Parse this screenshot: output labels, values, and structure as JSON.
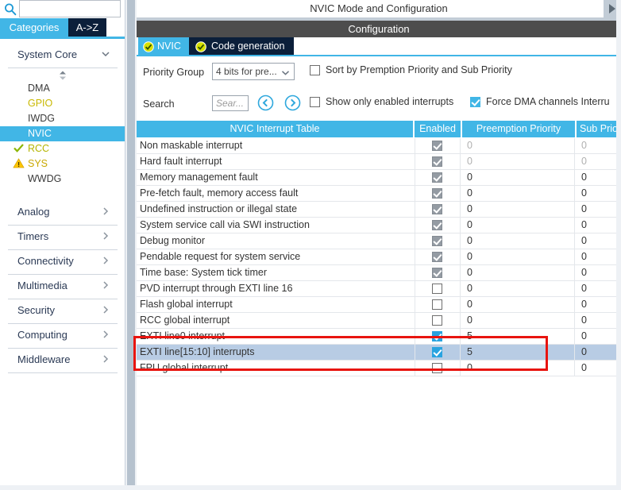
{
  "sidebar": {
    "search": {
      "placeholder": "",
      "value": "",
      "icon": "search-icon"
    },
    "tabs": [
      {
        "label": "Categories",
        "active": true
      },
      {
        "label": "A->Z",
        "active": false
      }
    ],
    "groups": [
      {
        "label": "System Core",
        "expanded": true,
        "items": [
          {
            "label": "DMA",
            "mark": "none",
            "selected": false
          },
          {
            "label": "GPIO",
            "mark": "none",
            "selected": false,
            "color": "#c9b800"
          },
          {
            "label": "IWDG",
            "mark": "none",
            "selected": false
          },
          {
            "label": "NVIC",
            "mark": "none",
            "selected": true
          },
          {
            "label": "RCC",
            "mark": "check",
            "selected": false,
            "color": "#b5b500"
          },
          {
            "label": "SYS",
            "mark": "warning",
            "selected": false,
            "color": "#c9a800"
          },
          {
            "label": "WWDG",
            "mark": "none",
            "selected": false
          }
        ]
      },
      {
        "label": "Analog",
        "expanded": false,
        "items": []
      },
      {
        "label": "Timers",
        "expanded": false,
        "items": []
      },
      {
        "label": "Connectivity",
        "expanded": false,
        "items": []
      },
      {
        "label": "Multimedia",
        "expanded": false,
        "items": []
      },
      {
        "label": "Security",
        "expanded": false,
        "items": []
      },
      {
        "label": "Computing",
        "expanded": false,
        "items": []
      },
      {
        "label": "Middleware",
        "expanded": false,
        "items": []
      }
    ]
  },
  "main": {
    "title": "NVIC Mode and Configuration",
    "configuration_bar": "Configuration",
    "tabs": [
      {
        "label": "NVIC",
        "active": true,
        "icon": "ok-check-icon"
      },
      {
        "label": "Code generation",
        "active": false,
        "icon": "ok-check-icon"
      }
    ],
    "controls": {
      "priority_group_label": "Priority Group",
      "priority_group_value": "4 bits for pre...",
      "search_label": "Search",
      "search_placeholder": "Sear...",
      "search_value": "",
      "nav_prev_icon": "chevron-left-circle-icon",
      "nav_next_icon": "chevron-right-circle-icon",
      "checkboxes": [
        {
          "label": "Sort by Premption Priority and Sub Priority",
          "checked": false
        },
        {
          "label": "Show only enabled interrupts",
          "checked": false
        },
        {
          "label": "Force DMA channels Interru",
          "checked": true
        }
      ]
    },
    "table": {
      "headers": [
        "NVIC Interrupt Table",
        "Enabled",
        "Preemption Priority",
        "Sub Prio"
      ],
      "rows": [
        {
          "name": "Non maskable interrupt",
          "enabled": "disabled-checked",
          "preemption": "0",
          "sub": "0",
          "dim": true,
          "selected": false
        },
        {
          "name": "Hard fault interrupt",
          "enabled": "disabled-checked",
          "preemption": "0",
          "sub": "0",
          "dim": true,
          "selected": false
        },
        {
          "name": "Memory management fault",
          "enabled": "disabled-checked",
          "preemption": "0",
          "sub": "0",
          "dim": false,
          "selected": false
        },
        {
          "name": "Pre-fetch fault, memory access fault",
          "enabled": "disabled-checked",
          "preemption": "0",
          "sub": "0",
          "dim": false,
          "selected": false
        },
        {
          "name": "Undefined instruction or illegal state",
          "enabled": "disabled-checked",
          "preemption": "0",
          "sub": "0",
          "dim": false,
          "selected": false
        },
        {
          "name": "System service call via SWI instruction",
          "enabled": "disabled-checked",
          "preemption": "0",
          "sub": "0",
          "dim": false,
          "selected": false
        },
        {
          "name": "Debug monitor",
          "enabled": "disabled-checked",
          "preemption": "0",
          "sub": "0",
          "dim": false,
          "selected": false
        },
        {
          "name": "Pendable request for system service",
          "enabled": "disabled-checked",
          "preemption": "0",
          "sub": "0",
          "dim": false,
          "selected": false
        },
        {
          "name": "Time base: System tick timer",
          "enabled": "disabled-checked",
          "preemption": "0",
          "sub": "0",
          "dim": false,
          "selected": false
        },
        {
          "name": "PVD interrupt through EXTI line 16",
          "enabled": "unchecked",
          "preemption": "0",
          "sub": "0",
          "dim": false,
          "selected": false
        },
        {
          "name": "Flash global interrupt",
          "enabled": "unchecked",
          "preemption": "0",
          "sub": "0",
          "dim": false,
          "selected": false
        },
        {
          "name": "RCC global interrupt",
          "enabled": "unchecked",
          "preemption": "0",
          "sub": "0",
          "dim": false,
          "selected": false
        },
        {
          "name": "EXTI line0 interrupt",
          "enabled": "checked",
          "preemption": "5",
          "sub": "0",
          "dim": false,
          "selected": false
        },
        {
          "name": "EXTI line[15:10] interrupts",
          "enabled": "checked",
          "preemption": "5",
          "sub": "0",
          "dim": false,
          "selected": true
        },
        {
          "name": "FPU global interrupt",
          "enabled": "unchecked",
          "preemption": "0",
          "sub": "0",
          "dim": false,
          "selected": false
        }
      ]
    }
  },
  "annotation": {
    "color": "#e8140f",
    "shape": "rectangle",
    "rows_highlighted": 2
  }
}
